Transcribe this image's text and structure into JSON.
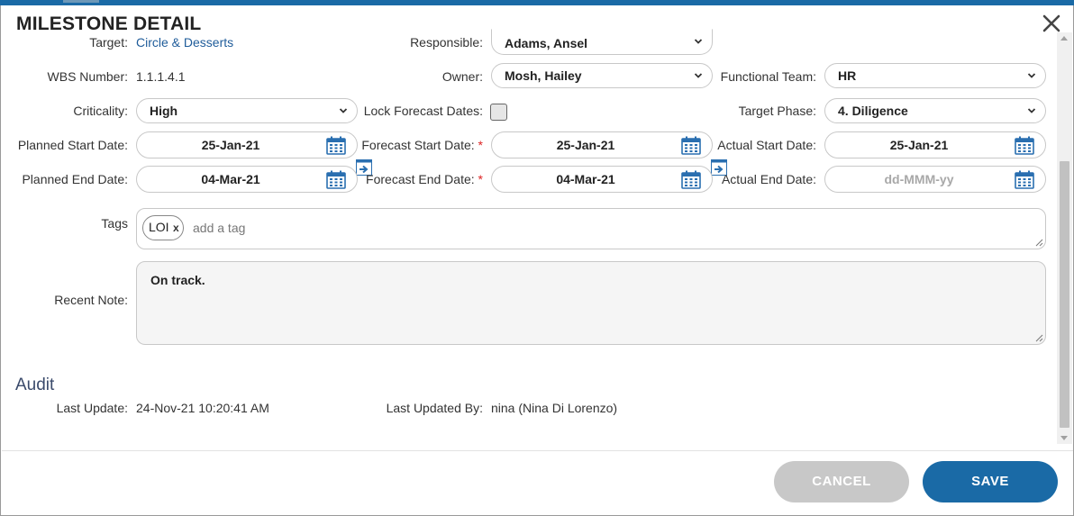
{
  "dialog": {
    "title": "MILESTONE DETAIL"
  },
  "fields": {
    "target_label": "Target:",
    "target_value": "Circle & Desserts",
    "responsible_label": "Responsible:",
    "responsible_value": "Adams, Ansel",
    "wbs_label": "WBS Number:",
    "wbs_value": "1.1.1.4.1",
    "owner_label": "Owner:",
    "owner_value": "Mosh, Hailey",
    "functional_team_label": "Functional Team:",
    "functional_team_value": "HR",
    "criticality_label": "Criticality:",
    "criticality_value": "High",
    "lock_forecast_label": "Lock Forecast Dates:",
    "target_phase_label": "Target Phase:",
    "target_phase_value": "4. Diligence",
    "planned_start_label": "Planned Start Date:",
    "planned_start_value": "25-Jan-21",
    "forecast_start_label": "Forecast Start Date:",
    "forecast_start_value": "25-Jan-21",
    "actual_start_label": "Actual Start Date:",
    "actual_start_value": "25-Jan-21",
    "planned_end_label": "Planned End Date:",
    "planned_end_value": "04-Mar-21",
    "forecast_end_label": "Forecast End Date:",
    "forecast_end_value": "04-Mar-21",
    "actual_end_label": "Actual End Date:",
    "actual_end_placeholder": "dd-MMM-yy",
    "required_mark": "*",
    "tags_label": "Tags",
    "tags": [
      {
        "label": "LOI",
        "remove": "x"
      }
    ],
    "add_tag_placeholder": "add a tag",
    "recent_note_label": "Recent Note:",
    "recent_note_value": "On track."
  },
  "audit": {
    "heading": "Audit",
    "last_update_label": "Last Update:",
    "last_update_value": "24-Nov-21 10:20:41 AM",
    "last_updated_by_label": "Last Updated By:",
    "last_updated_by_value": "nina (Nina Di Lorenzo)"
  },
  "buttons": {
    "cancel": "CANCEL",
    "save": "SAVE",
    "close": "✕"
  },
  "colors": {
    "accent": "#1a6aa6",
    "link": "#1f5c9a",
    "required": "#dd2222",
    "cancel_bg": "#c8c8c8"
  },
  "icons": {
    "calendar": "calendar-icon",
    "copy": "copy-date-arrow-icon",
    "close": "close-icon",
    "chevron": "chevron-down-icon"
  }
}
